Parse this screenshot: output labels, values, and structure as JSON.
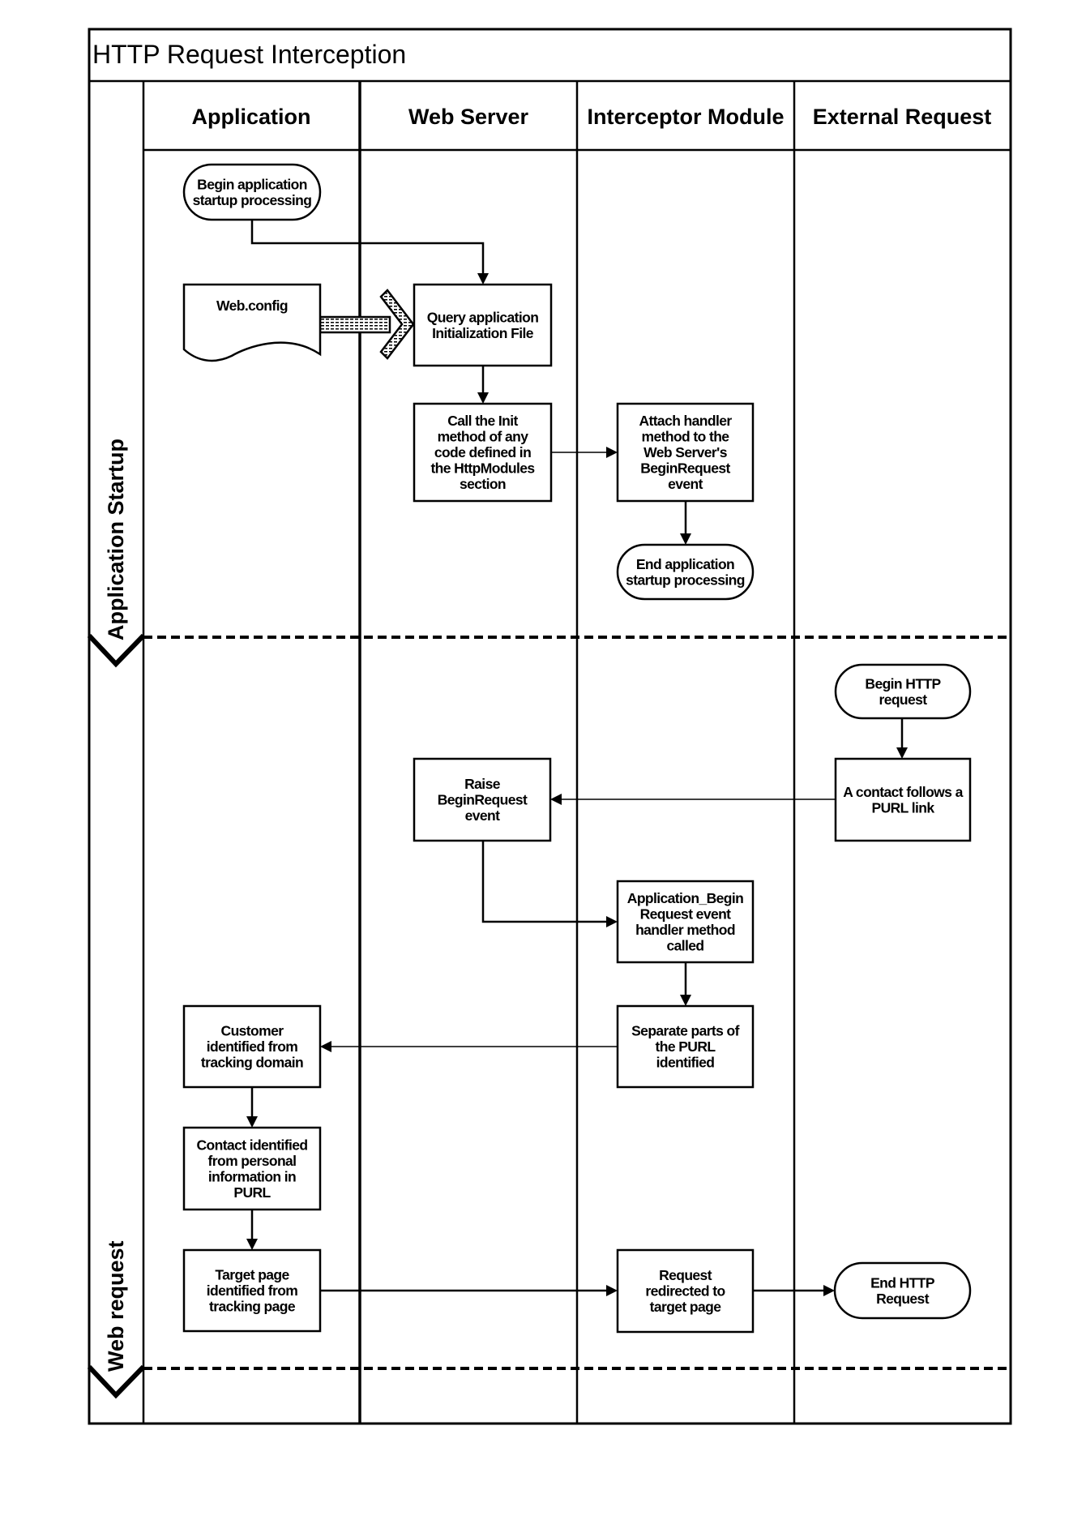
{
  "diagram": {
    "title": "HTTP Request Interception",
    "columns": [
      "Application",
      "Web Server",
      "Interceptor Module",
      "External Request"
    ],
    "lanes": [
      "Application Startup",
      "Web request"
    ],
    "nodes": {
      "begin_startup": {
        "shape": "terminator",
        "lines": [
          "Begin application",
          "startup processing"
        ]
      },
      "web_config": {
        "shape": "document",
        "lines": [
          "Web.config"
        ]
      },
      "query_init": {
        "shape": "process",
        "lines": [
          "Query application",
          "Initialization File"
        ]
      },
      "call_init": {
        "shape": "process",
        "lines": [
          "Call the Init",
          "method of any",
          "code defined in",
          "the HttpModules",
          "section"
        ]
      },
      "attach_handler": {
        "shape": "process",
        "lines": [
          "Attach handler",
          "method to the",
          "Web Server's",
          "BeginRequest",
          "event"
        ]
      },
      "end_startup": {
        "shape": "terminator",
        "lines": [
          "End application",
          "startup processing"
        ]
      },
      "begin_http": {
        "shape": "terminator",
        "lines": [
          "Begin HTTP",
          "request"
        ]
      },
      "contact_follows": {
        "shape": "process",
        "lines": [
          "A contact follows a",
          "PURL link"
        ]
      },
      "raise_begin": {
        "shape": "process",
        "lines": [
          "Raise",
          "BeginRequest",
          "event"
        ]
      },
      "app_begin_handler": {
        "shape": "process",
        "lines": [
          "Application_Begin",
          "Request event",
          "handler method",
          "called"
        ]
      },
      "separate_parts": {
        "shape": "process",
        "lines": [
          "Separate parts of",
          "the PURL",
          "identified"
        ]
      },
      "customer_identified": {
        "shape": "process",
        "lines": [
          "Customer",
          "identified from",
          "tracking domain"
        ]
      },
      "contact_identified": {
        "shape": "process",
        "lines": [
          "Contact identified",
          "from personal",
          "information in",
          "PURL"
        ]
      },
      "target_identified": {
        "shape": "process",
        "lines": [
          "Target page",
          "identified from",
          "tracking page"
        ]
      },
      "request_redirected": {
        "shape": "process",
        "lines": [
          "Request",
          "redirected to",
          "target page"
        ]
      },
      "end_http": {
        "shape": "terminator",
        "lines": [
          "End HTTP",
          "Request"
        ]
      }
    },
    "edges": [
      {
        "from": "begin_startup",
        "to": "query_init"
      },
      {
        "from": "web_config",
        "to": "query_init",
        "style": "striped-block-arrow"
      },
      {
        "from": "query_init",
        "to": "call_init"
      },
      {
        "from": "call_init",
        "to": "attach_handler"
      },
      {
        "from": "attach_handler",
        "to": "end_startup"
      },
      {
        "from": "begin_http",
        "to": "contact_follows"
      },
      {
        "from": "contact_follows",
        "to": "raise_begin"
      },
      {
        "from": "raise_begin",
        "to": "app_begin_handler"
      },
      {
        "from": "app_begin_handler",
        "to": "separate_parts"
      },
      {
        "from": "separate_parts",
        "to": "customer_identified"
      },
      {
        "from": "customer_identified",
        "to": "contact_identified"
      },
      {
        "from": "contact_identified",
        "to": "target_identified"
      },
      {
        "from": "target_identified",
        "to": "request_redirected"
      },
      {
        "from": "request_redirected",
        "to": "end_http"
      }
    ]
  }
}
